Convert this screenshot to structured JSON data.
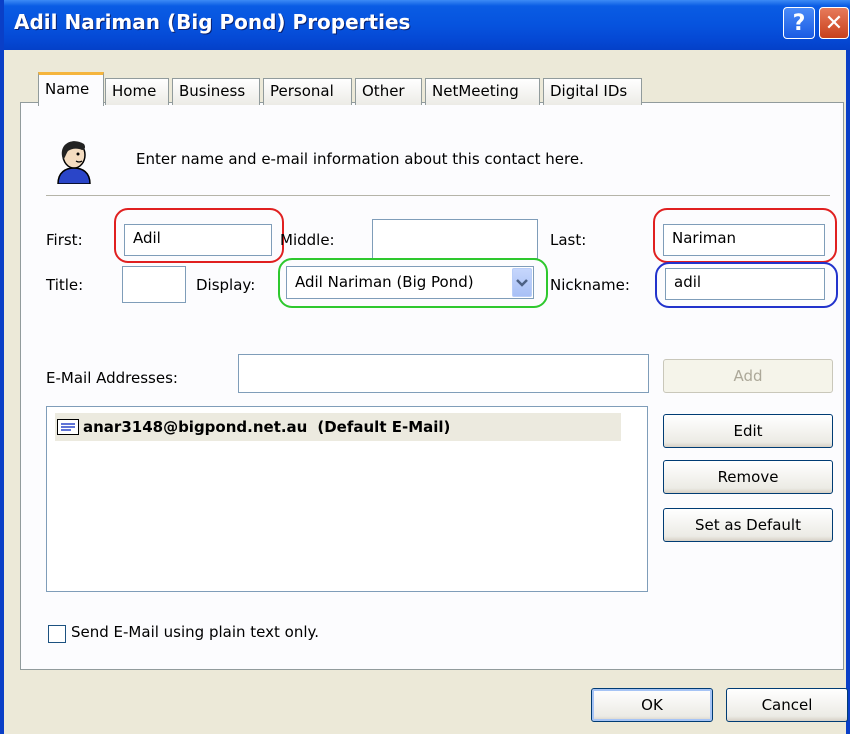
{
  "window": {
    "title": "Adil Nariman (Big Pond) Properties",
    "help_glyph": "?",
    "close_glyph": "✕"
  },
  "tabs": [
    {
      "label": "Name",
      "active": true
    },
    {
      "label": "Home",
      "active": false
    },
    {
      "label": "Business",
      "active": false
    },
    {
      "label": "Personal",
      "active": false
    },
    {
      "label": "Other",
      "active": false
    },
    {
      "label": "NetMeeting",
      "active": false
    },
    {
      "label": "Digital IDs",
      "active": false
    }
  ],
  "header": {
    "icon": "contact-person-icon",
    "intro": "Enter name and e-mail information about this contact here."
  },
  "fields": {
    "first": {
      "label": "First:",
      "value": "Adil"
    },
    "middle": {
      "label": "Middle:",
      "value": ""
    },
    "last": {
      "label": "Last:",
      "value": "Nariman"
    },
    "title": {
      "label": "Title:",
      "value": ""
    },
    "display": {
      "label": "Display:",
      "value": "Adil Nariman (Big Pond)"
    },
    "nickname": {
      "label": "Nickname:",
      "value": "adil"
    }
  },
  "email": {
    "label": "E-Mail Addresses:",
    "input_value": "",
    "entries": [
      {
        "address": "anar3148@bigpond.net.au",
        "note": "(Default E-Mail)",
        "icon": "mail-icon"
      }
    ],
    "buttons": {
      "add": "Add",
      "edit": "Edit",
      "remove": "Remove",
      "set_default": "Set as Default"
    }
  },
  "plain_text": {
    "label": "Send E-Mail using plain text only.",
    "checked": false
  },
  "footer": {
    "ok": "OK",
    "cancel": "Cancel"
  },
  "colors": {
    "titlebar": "#0653de",
    "highlight_red": "#e02020",
    "highlight_green": "#2ec82e",
    "highlight_blue": "#2233cc",
    "active_tab_accent": "#f5b53e"
  }
}
